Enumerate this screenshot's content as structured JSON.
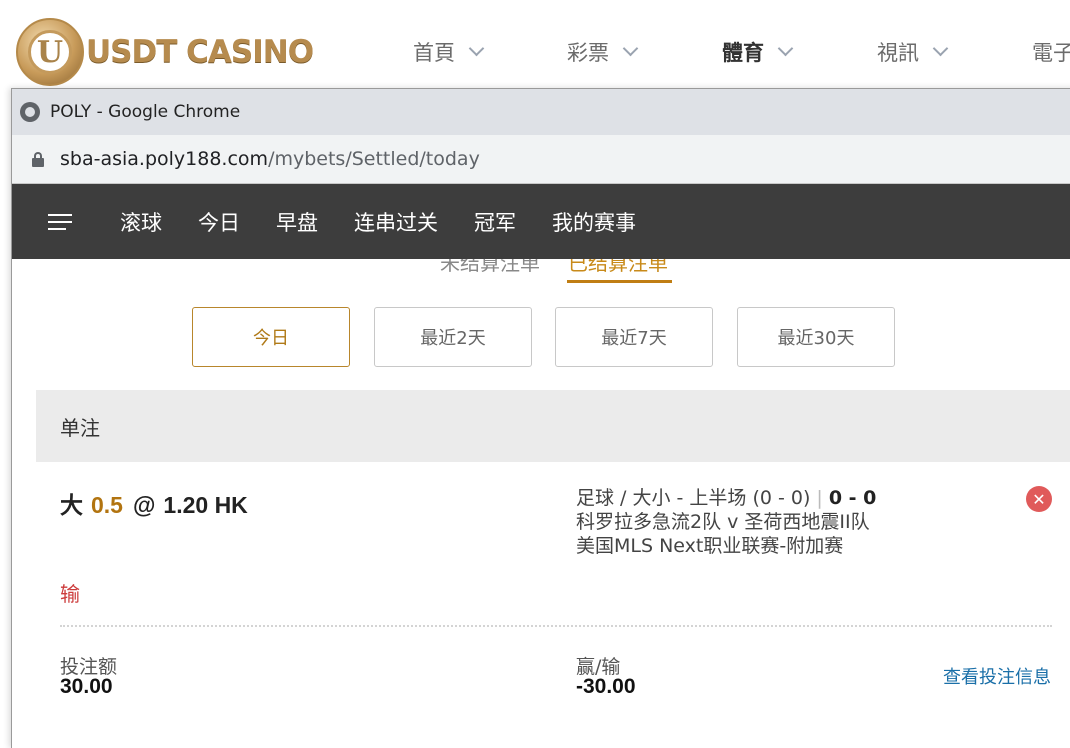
{
  "site": {
    "logo_letter": "U",
    "logo_text": "USDT CASINO",
    "nav": [
      {
        "label": "首頁"
      },
      {
        "label": "彩票"
      },
      {
        "label": "體育"
      },
      {
        "label": "視訊"
      },
      {
        "label": "電子"
      }
    ]
  },
  "chrome": {
    "title": "POLY - Google Chrome",
    "url_host": "sba-asia.poly188.com",
    "url_path": "/mybets/Settled/today"
  },
  "app_nav": {
    "tabs": [
      {
        "label": "滚球"
      },
      {
        "label": "今日"
      },
      {
        "label": "早盘"
      },
      {
        "label": "连串过关"
      },
      {
        "label": "冠军"
      },
      {
        "label": "我的赛事"
      }
    ]
  },
  "settle_tabs": [
    {
      "label": "未结算注单"
    },
    {
      "label": "已结算注单"
    }
  ],
  "range_buttons": [
    {
      "label": "今日"
    },
    {
      "label": "最近2天"
    },
    {
      "label": "最近7天"
    },
    {
      "label": "最近30天"
    }
  ],
  "bet_type_label": "单注",
  "bet": {
    "selection": "大",
    "line": "0.5",
    "at": "@",
    "odds": "1.20 HK",
    "market": "足球 / 大小 - 上半场 (0 - 0)",
    "separator": "|",
    "score": "0 - 0",
    "teams": "科罗拉多急流2队 v 圣荷西地震II队",
    "league": "美国MLS Next职业联赛-附加赛",
    "close_glyph": "✕",
    "result": "输",
    "stake_label": "投注额",
    "stake_value": "30.00",
    "pl_label": "赢/输",
    "pl_value": "-30.00",
    "details_link": "查看投注信息"
  }
}
